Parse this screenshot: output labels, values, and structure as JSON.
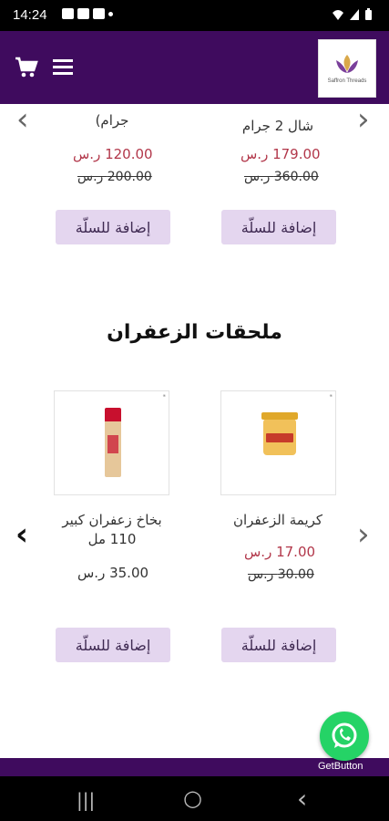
{
  "status": {
    "time": "14:24"
  },
  "header": {
    "logo_text": "Saffron Threads",
    "colors": {
      "header_bg": "#3f0b5e"
    }
  },
  "top_row": {
    "products": [
      {
        "name_line1": "شال 2 جرام",
        "price_new": "179.00 ر.س",
        "price_old": "360.00 ر.س",
        "button": "إضافة للسلّة"
      },
      {
        "name_line1": "جرام)",
        "price_new": "120.00 ر.س",
        "price_old": "200.00 ر.س",
        "button": "إضافة للسلّة"
      }
    ]
  },
  "accessories": {
    "title": "ملحقات الزعفران",
    "products": [
      {
        "name_line1": "كريمة الزعفران",
        "name_line2": "",
        "price_new": "17.00 ر.س",
        "price_old": "30.00 ر.س",
        "button": "إضافة للسلّة"
      },
      {
        "name_line1": "بخاخ زعفران كبير",
        "name_line2": "110 مل",
        "price": "35.00 ر.س",
        "button": "إضافة للسلّة"
      }
    ]
  },
  "widget": {
    "label": "GetButton"
  },
  "nav": {
    "recent": "|||",
    "home": "○",
    "back": "‹"
  }
}
